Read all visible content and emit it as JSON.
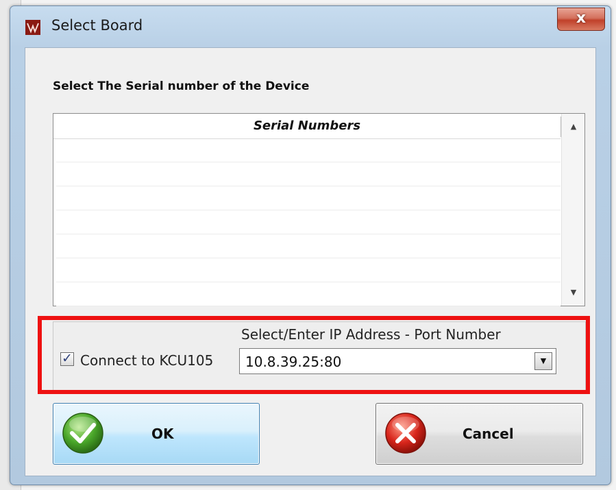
{
  "window": {
    "title": "Select Board",
    "close_label": "x"
  },
  "prompt": "Select The Serial number of the Device",
  "serial_list": {
    "header": "Serial Numbers",
    "rows": [
      "",
      "",
      "",
      "",
      "",
      "",
      ""
    ],
    "scroll_up_icon": "arrow-up-icon",
    "scroll_down_icon": "arrow-down-icon"
  },
  "connection": {
    "checkbox_label": "Connect to KCU105",
    "checkbox_checked": true,
    "ip_label": "Select/Enter IP Address - Port Number",
    "ip_value": "10.8.39.25:80"
  },
  "buttons": {
    "ok_label": "OK",
    "cancel_label": "Cancel"
  },
  "colors": {
    "highlight": "#ee1111",
    "ok_icon": "#4aa72a",
    "cancel_icon": "#d8261c"
  }
}
